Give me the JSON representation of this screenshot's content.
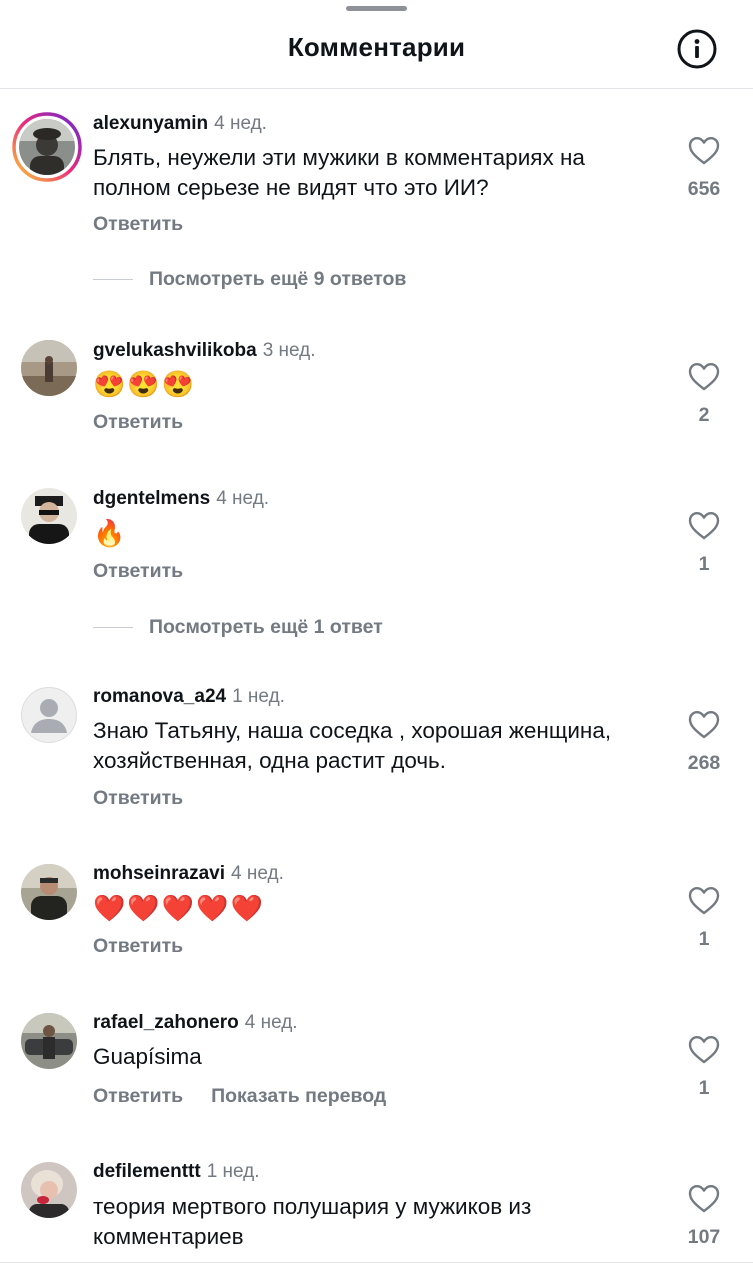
{
  "header": {
    "title": "Комментарии",
    "info_icon": "info-circle-icon"
  },
  "ui": {
    "reply_label": "Ответить",
    "like_icon": "heart-outline-icon",
    "colors": {
      "text": "#0f1419",
      "secondary": "#737a82",
      "divider": "#e3e5e8",
      "story_ring": [
        "#f9ce34",
        "#ee2a7b",
        "#6228d7"
      ]
    }
  },
  "comments": [
    {
      "username": "alexunyamin",
      "time": "4 нед.",
      "text": "Блять, неужели эти мужики в комментариях на полном серьезе не видят что это ИИ?",
      "likes": "656",
      "has_story": true,
      "more_replies": "Посмотреть ещё 9 ответов"
    },
    {
      "username": "gvelukashvilikoba",
      "time": "3 нед.",
      "text": "😍😍😍",
      "likes": "2"
    },
    {
      "username": "dgentelmens",
      "time": "4 нед.",
      "text": "🔥",
      "likes": "1",
      "more_replies": "Посмотреть ещё 1 ответ"
    },
    {
      "username": "romanova_a24",
      "time": "1 нед.",
      "text": "Знаю Татьяну, наша соседка , хорошая женщина, хозяйственная, одна растит дочь.",
      "likes": "268",
      "default_avatar": true
    },
    {
      "username": "mohseinrazavi",
      "time": "4 нед.",
      "text": "❤️❤️❤️❤️❤️",
      "likes": "1"
    },
    {
      "username": "rafael_zahonero",
      "time": "4 нед.",
      "text": "Guapísima",
      "likes": "1",
      "translate_label": "Показать перевод"
    },
    {
      "username": "defilementtt",
      "time": "1 нед.",
      "text": "теория мертвого полушария у мужиков из комментариев",
      "likes": "107"
    }
  ]
}
